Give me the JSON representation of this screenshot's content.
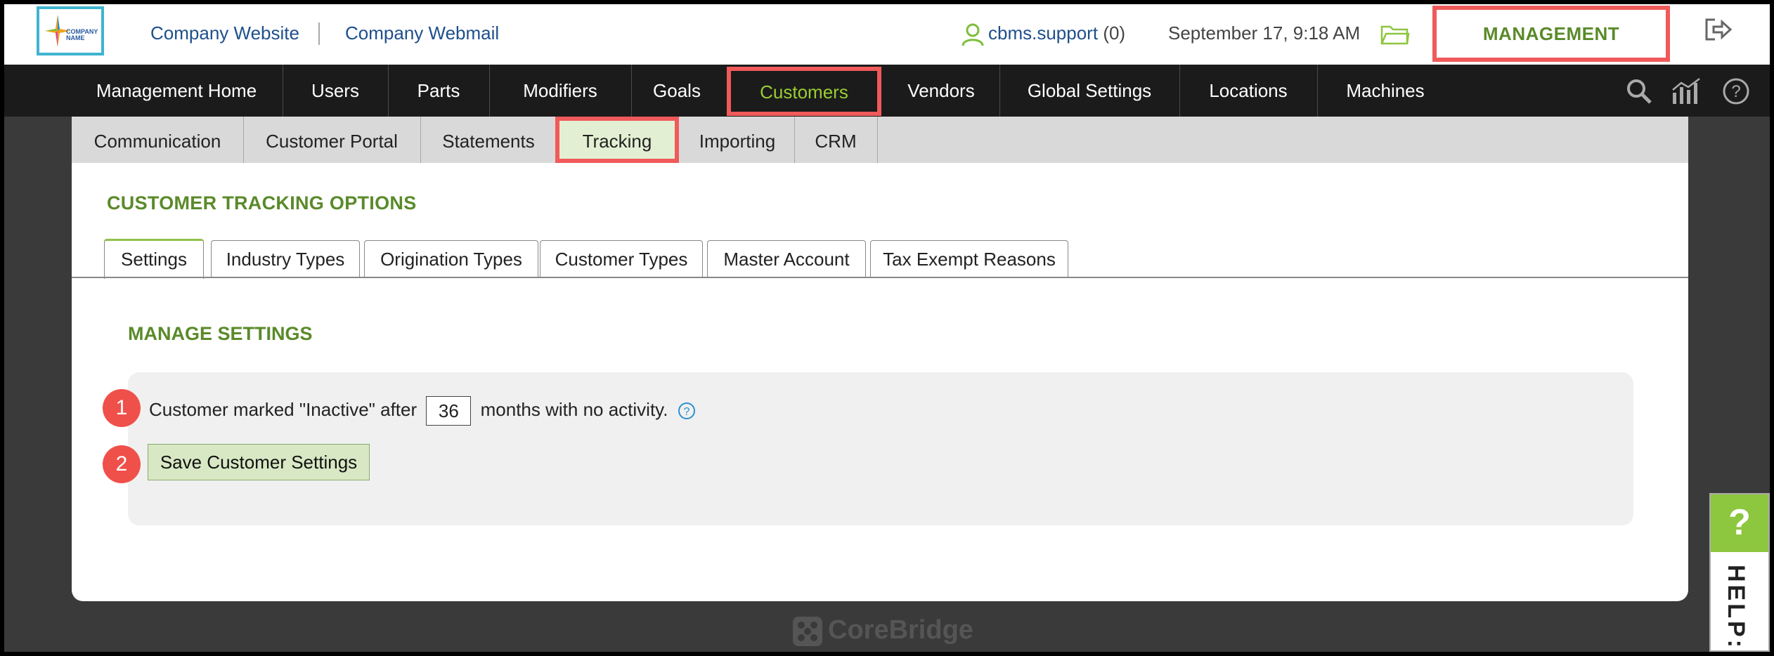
{
  "header": {
    "links": [
      "Company Website",
      "Company Webmail"
    ],
    "logo_text": "COMPANY NAME",
    "user": "cbms.support",
    "user_count": "(0)",
    "datetime": "September 17, 9:18 AM",
    "management": "MANAGEMENT"
  },
  "nav": {
    "items": [
      "Management Home",
      "Users",
      "Parts",
      "Modifiers",
      "Goals",
      "Customers",
      "Vendors",
      "Global Settings",
      "Locations",
      "Machines"
    ],
    "active": "Customers"
  },
  "subnav": {
    "items": [
      "Communication",
      "Customer Portal",
      "Statements",
      "Tracking",
      "Importing",
      "CRM"
    ],
    "active": "Tracking"
  },
  "panel": {
    "title": "CUSTOMER TRACKING OPTIONS",
    "tabs": [
      "Settings",
      "Industry Types",
      "Origination Types",
      "Customer Types",
      "Master Account",
      "Tax Exempt Reasons"
    ],
    "active_tab": "Settings",
    "section_title": "MANAGE SETTINGS",
    "setting": {
      "prefix": "Customer marked \"Inactive\" after",
      "months_value": "36",
      "suffix": "months with no activity."
    },
    "save_button": "Save Customer Settings",
    "badges": [
      "1",
      "2"
    ]
  },
  "footer": {
    "brand": "CoreBridge"
  },
  "help": {
    "symbol": "?",
    "label": "HELP:"
  },
  "colors": {
    "accent_green": "#5a8a2a",
    "highlight_red": "#f05a5a",
    "nav_bg": "#1b1b1b"
  }
}
